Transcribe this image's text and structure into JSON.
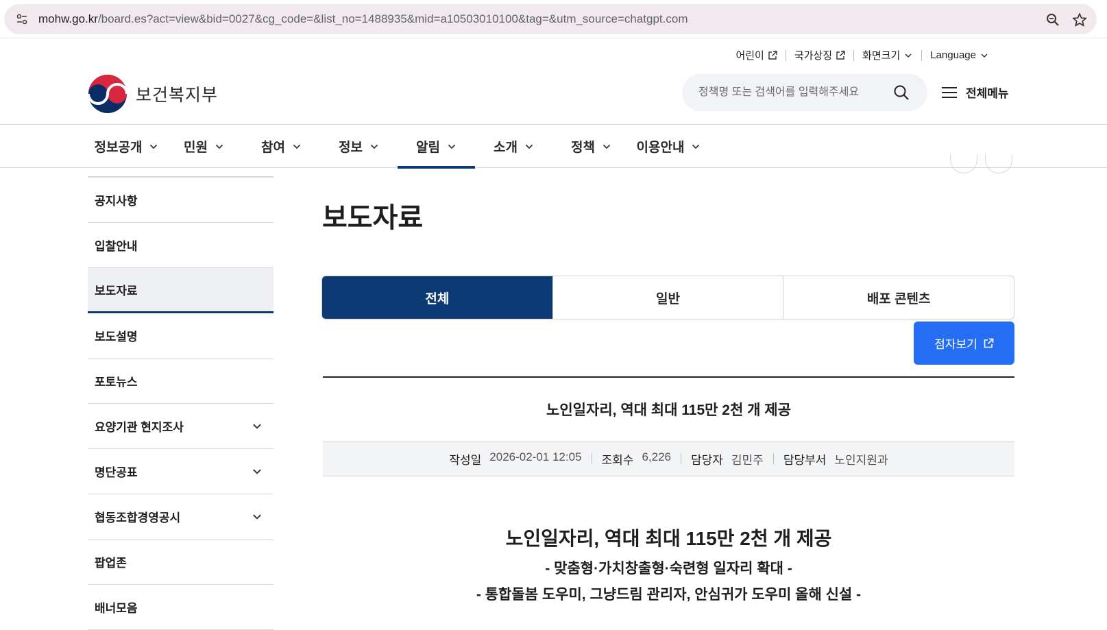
{
  "browser": {
    "url_host": "mohw.go.kr",
    "url_path": "/board.es?act=view&bid=0027&cg_code=&list_no=1488935&mid=a10503010100&tag=&utm_source=chatgpt.com"
  },
  "utility": {
    "kids": "어린이",
    "symbols": "국가상징",
    "screen_size": "화면크기",
    "language": "Language"
  },
  "header": {
    "logo_text": "보건복지부",
    "search_placeholder": "정책명 또는 검색어를 입력해주세요",
    "all_menu": "전체메뉴"
  },
  "gnb": [
    "정보공개",
    "민원",
    "참여",
    "정보",
    "알림",
    "소개",
    "정책",
    "이용안내"
  ],
  "gnb_active": "알림",
  "sidebar": {
    "items": [
      {
        "label": "공지사항"
      },
      {
        "label": "입찰안내"
      },
      {
        "label": "보도자료"
      },
      {
        "label": "보도설명"
      },
      {
        "label": "포토뉴스"
      },
      {
        "label": "요양기관 현지조사"
      },
      {
        "label": "명단공표"
      },
      {
        "label": "협동조합경영공시"
      },
      {
        "label": "팝업존"
      },
      {
        "label": "배너모음"
      }
    ],
    "active": "보도자료"
  },
  "main": {
    "page_title": "보도자료",
    "tabs": [
      {
        "label": "전체"
      },
      {
        "label": "일반"
      },
      {
        "label": "배포 콘텐츠"
      }
    ],
    "braille_button": "점자보기",
    "article": {
      "title": "노인일자리, 역대 최대 115만 2천 개 제공",
      "meta": {
        "date_label": "작성일",
        "date_value": "2026-02-01 12:05",
        "views_label": "조회수",
        "views_value": "6,226",
        "person_label": "담당자",
        "person_value": "김민주",
        "dept_label": "담당부서",
        "dept_value": "노인지원과"
      },
      "body_title": "노인일자리, 역대 최대 115만 2천 개 제공",
      "body_sub1": "- 맞춤형·가치창출형·숙련형 일자리 확대 -",
      "body_sub2": "- 통합돌봄 도우미, 그냥드림 관리자, 안심귀가 도우미 올해 신설 -"
    }
  },
  "colors": {
    "navy": "#0b3a75",
    "blue_button": "#256ef4",
    "address_bar": "#f2e9ee"
  }
}
